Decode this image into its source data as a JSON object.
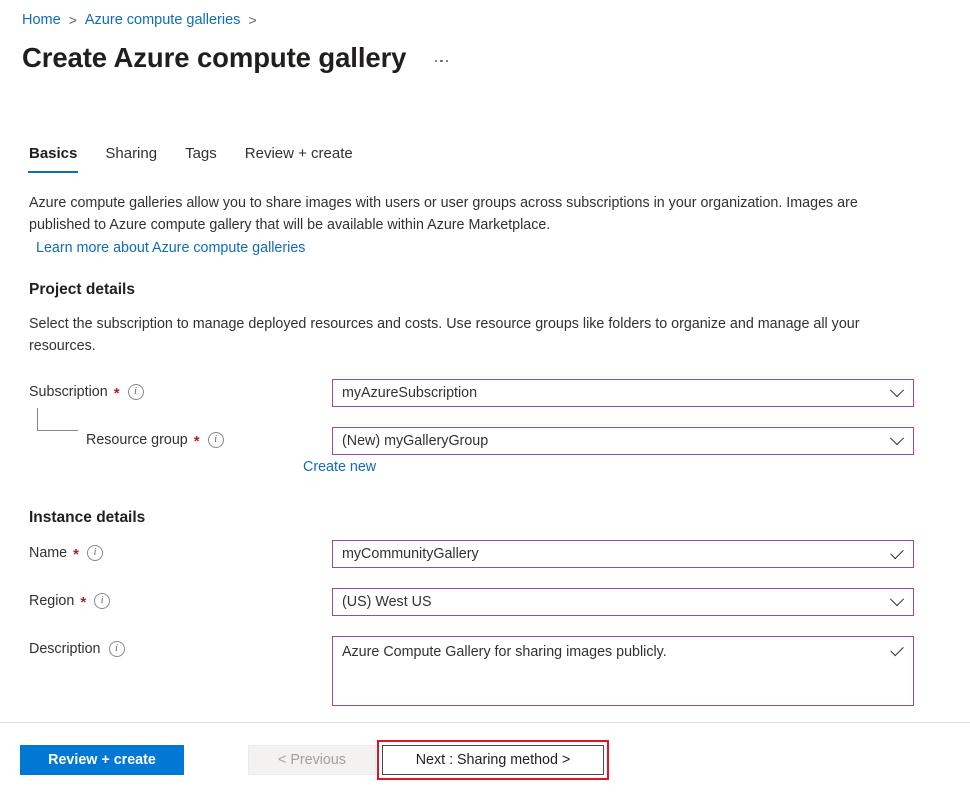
{
  "breadcrumb": {
    "items": [
      {
        "label": "Home"
      },
      {
        "label": "Azure compute galleries"
      }
    ],
    "separator": ">"
  },
  "header": {
    "title": "Create Azure compute gallery",
    "more_menu": "more-commands"
  },
  "tabs": [
    {
      "label": "Basics",
      "active": true
    },
    {
      "label": "Sharing",
      "active": false
    },
    {
      "label": "Tags",
      "active": false
    },
    {
      "label": "Review + create",
      "active": false
    }
  ],
  "intro": {
    "text": "Azure compute galleries allow you to share images with users or user groups across subscriptions in your organization. Images are published to Azure compute gallery that will be available within Azure Marketplace.",
    "link": "Learn more about Azure compute galleries"
  },
  "project_details": {
    "heading": "Project details",
    "description": "Select the subscription to manage deployed resources and costs. Use resource groups like folders to organize and manage all your resources.",
    "subscription": {
      "label": "Subscription",
      "required": "*",
      "value": "myAzureSubscription",
      "glyph": "chevron-down-icon"
    },
    "resource_group": {
      "label": "Resource group",
      "required": "*",
      "value": "(New) myGalleryGroup",
      "glyph": "chevron-down-icon",
      "create_new_link": "Create new"
    }
  },
  "instance_details": {
    "heading": "Instance details",
    "name": {
      "label": "Name",
      "required": "*",
      "value": "myCommunityGallery",
      "glyph": "checkmark-icon"
    },
    "region": {
      "label": "Region",
      "required": "*",
      "value": "(US) West US",
      "glyph": "chevron-down-icon"
    },
    "description": {
      "label": "Description",
      "required": "",
      "value": "Azure Compute Gallery for sharing images publicly.",
      "glyph": "checkmark-icon"
    }
  },
  "footer": {
    "review_create": "Review + create",
    "previous": "< Previous",
    "next": "Next : Sharing method >"
  },
  "colors": {
    "link": "#0f6cbd",
    "primary_button": "#0078d4",
    "field_border": "#8f4bb0",
    "required_asterisk": "#a4262c",
    "highlight": "#e81123",
    "tab_underline": "#0f6cbd"
  }
}
